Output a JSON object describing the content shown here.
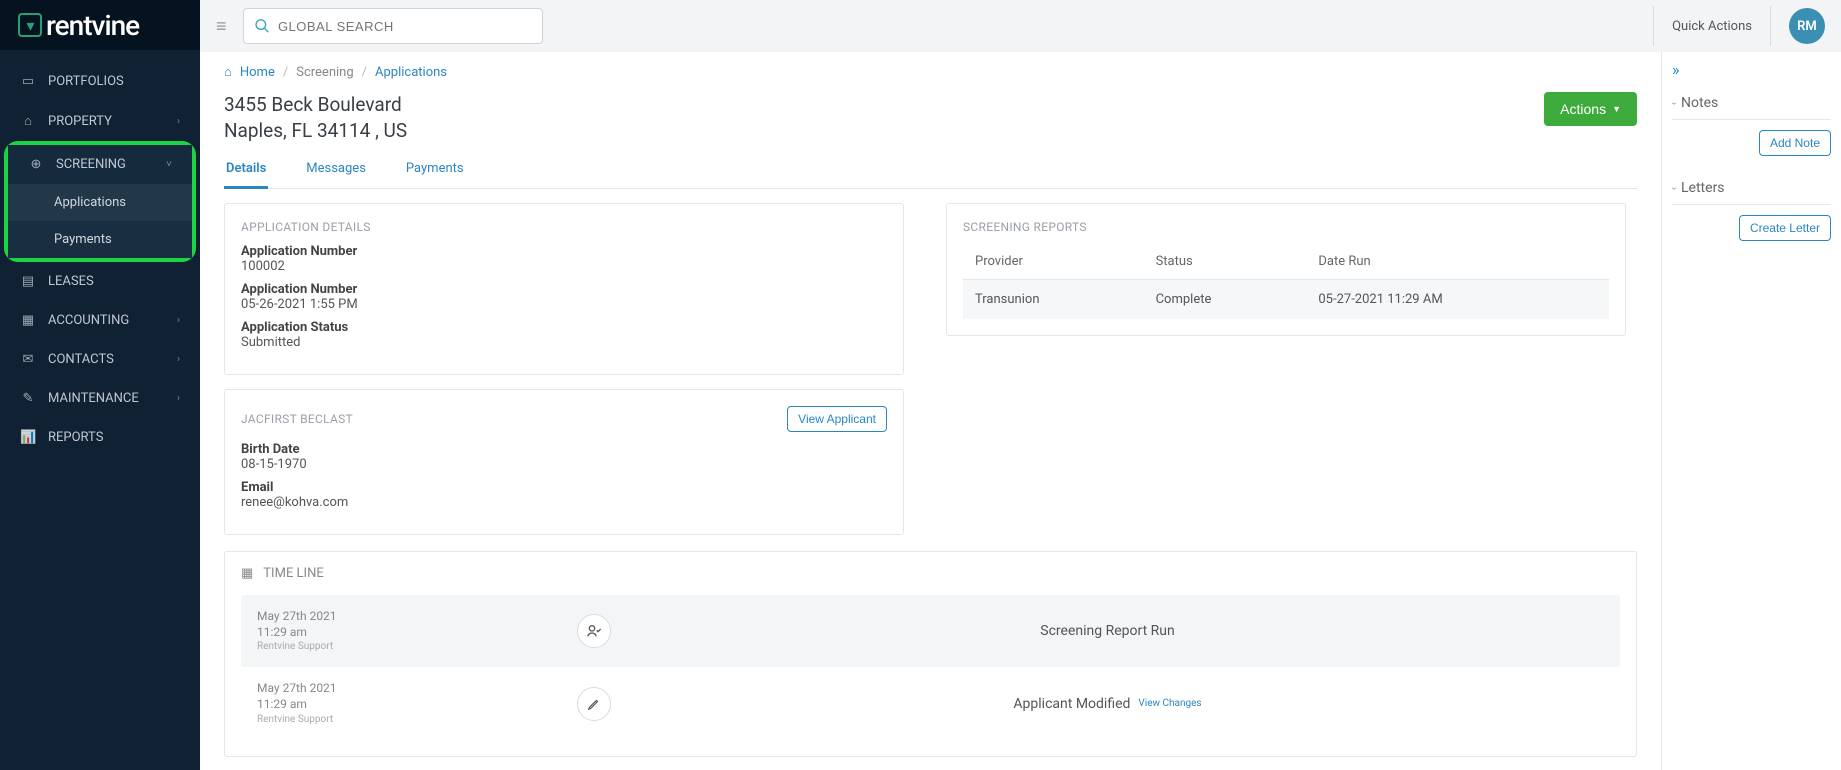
{
  "brand": {
    "name": "rentvine"
  },
  "search": {
    "placeholder": "GLOBAL SEARCH"
  },
  "header": {
    "quick_actions": "Quick Actions",
    "avatar_initials": "RM"
  },
  "sidebar": {
    "items": [
      {
        "label": "PORTFOLIOS"
      },
      {
        "label": "PROPERTY"
      },
      {
        "label": "SCREENING"
      },
      {
        "label": "LEASES"
      },
      {
        "label": "ACCOUNTING"
      },
      {
        "label": "CONTACTS"
      },
      {
        "label": "MAINTENANCE"
      },
      {
        "label": "REPORTS"
      }
    ],
    "screening_sub": [
      {
        "label": "Applications"
      },
      {
        "label": "Payments"
      }
    ]
  },
  "breadcrumbs": {
    "home": "Home",
    "b1": "Screening",
    "b2": "Applications"
  },
  "page": {
    "title_line1": "3455 Beck Boulevard",
    "title_line2": "Naples, FL 34114 , US",
    "actions": "Actions"
  },
  "tabs": {
    "t0": "Details",
    "t1": "Messages",
    "t2": "Payments"
  },
  "app_details": {
    "title": "APPLICATION DETAILS",
    "f0_label": "Application Number",
    "f0_value": "100002",
    "f1_label": "Application Number",
    "f1_value": "05-26-2021 1:55 PM",
    "f2_label": "Application Status",
    "f2_value": "Submitted"
  },
  "applicant": {
    "title": "JACFIRST BECLAST",
    "view_btn": "View Applicant",
    "f0_label": "Birth Date",
    "f0_value": "08-15-1970",
    "f1_label": "Email",
    "f1_value": "renee@kohva.com"
  },
  "reports": {
    "title": "SCREENING REPORTS",
    "col0": "Provider",
    "col1": "Status",
    "col2": "Date Run",
    "rows": [
      {
        "c0": "Transunion",
        "c1": "Complete",
        "c2": "05-27-2021 11:29 AM"
      }
    ]
  },
  "timeline": {
    "title": "TIME LINE",
    "rows": [
      {
        "date": "May 27th 2021",
        "time": "11:29 am",
        "user": "Rentvine Support",
        "desc": "Screening Report Run",
        "link": ""
      },
      {
        "date": "May 27th 2021",
        "time": "11:29 am",
        "user": "Rentvine Support",
        "desc": "Applicant Modified",
        "link": "View Changes"
      }
    ]
  },
  "rightpanel": {
    "notes_title": "Notes",
    "add_note": "Add Note",
    "letters_title": "Letters",
    "create_letter": "Create Letter"
  }
}
